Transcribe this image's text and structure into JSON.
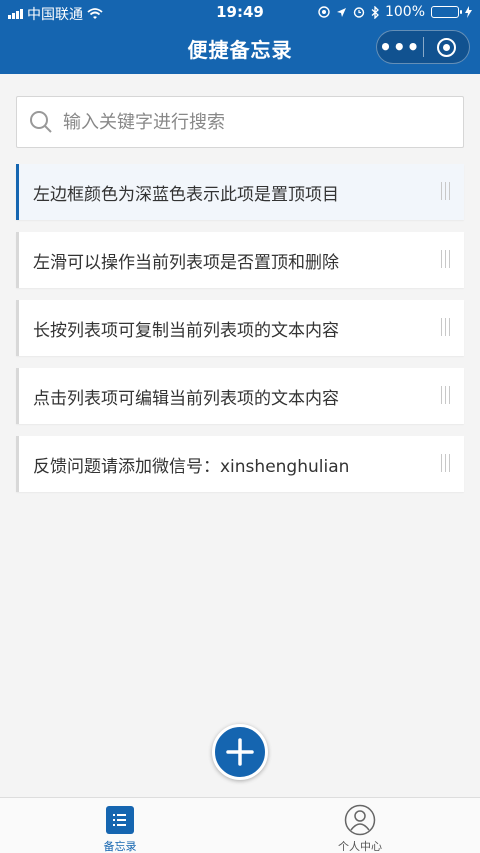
{
  "status_bar": {
    "carrier": "中国联通",
    "time": "19:49",
    "battery": "100%"
  },
  "header": {
    "title": "便捷备忘录",
    "more_label": "•••"
  },
  "search": {
    "placeholder": "输入关键字进行搜索",
    "value": ""
  },
  "list": {
    "items": [
      {
        "text": "左边框颜色为深蓝色表示此项是置顶项目",
        "pinned": true
      },
      {
        "text": "左滑可以操作当前列表项是否置顶和删除",
        "pinned": false
      },
      {
        "text": "长按列表项可复制当前列表项的文本内容",
        "pinned": false
      },
      {
        "text": "点击列表项可编辑当前列表项的文本内容",
        "pinned": false
      },
      {
        "text": "反馈问题请添加微信号：xinshenghulian",
        "pinned": false
      }
    ]
  },
  "fab": {
    "icon": "plus-icon"
  },
  "tabbar": {
    "tabs": [
      {
        "label": "备忘录",
        "icon": "list-icon",
        "active": true
      },
      {
        "label": "个人中心",
        "icon": "user-icon",
        "active": false
      }
    ]
  },
  "colors": {
    "primary": "#1565b0",
    "pinned_border": "#1565b0",
    "normal_border": "#d8d8d8",
    "background": "#f4f4f4"
  }
}
